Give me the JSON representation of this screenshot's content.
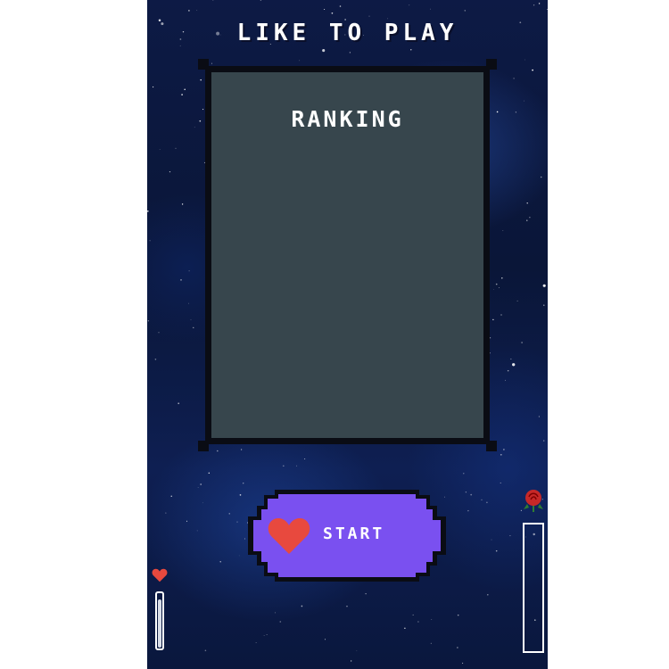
{
  "game": {
    "title": "LIKE TO PLAY",
    "ranking": {
      "heading": "RANKING",
      "entries": []
    },
    "start_button": {
      "label": "START",
      "icon": "heart-icon"
    },
    "left_meter": {
      "icon": "heart-icon",
      "level": 0.9
    },
    "right_meter": {
      "icon": "rose-icon",
      "level": 0
    }
  },
  "colors": {
    "panel": "#37464d",
    "frame": "#0a0c14",
    "button": "#7a50f0",
    "heart": "#e8493e",
    "text": "#ffffff"
  }
}
